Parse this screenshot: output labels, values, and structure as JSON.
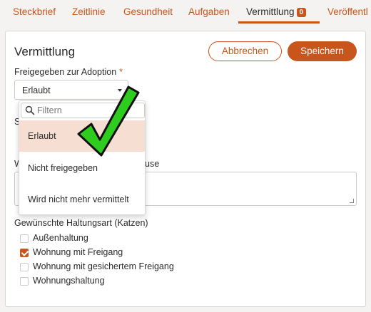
{
  "tabs": [
    {
      "label": "Steckbrief"
    },
    {
      "label": "Zeitlinie"
    },
    {
      "label": "Gesundheit"
    },
    {
      "label": "Aufgaben"
    },
    {
      "label": "Vermittlung",
      "badge": "0"
    },
    {
      "label": "Veröffentl"
    }
  ],
  "card": {
    "title": "Vermittlung",
    "cancel_label": "Abbrechen",
    "save_label": "Speichern"
  },
  "adoption": {
    "label": "Freigegeben zur Adoption",
    "required_mark": "*",
    "value": "Erlaubt"
  },
  "obscured_labels": {
    "s_fragment": "S",
    "w_fragment": "W",
    "w_suffix": "use"
  },
  "dropdown": {
    "filter_placeholder": "Filtern",
    "options": [
      {
        "label": "Erlaubt",
        "selected": true
      },
      {
        "label": "Nicht freigegeben",
        "selected": false
      },
      {
        "label": "Wird nicht mehr vermittelt",
        "selected": false
      }
    ]
  },
  "housing": {
    "label": "Gewünschte Haltungsart (Katzen)",
    "options": [
      {
        "label": "Außenhaltung",
        "checked": false
      },
      {
        "label": "Wohnung mit Freigang",
        "checked": true
      },
      {
        "label": "Wohnung mit gesichertem Freigang",
        "checked": false
      },
      {
        "label": "Wohnungshaltung",
        "checked": false
      }
    ]
  },
  "colors": {
    "accent": "#c8551b",
    "selected_bg": "#f6ded3",
    "checkmark_green": "#2ecc1f"
  },
  "icons": {
    "filter": "search-icon",
    "select": "chevron-down-icon",
    "overlay": "checkmark-icon"
  }
}
